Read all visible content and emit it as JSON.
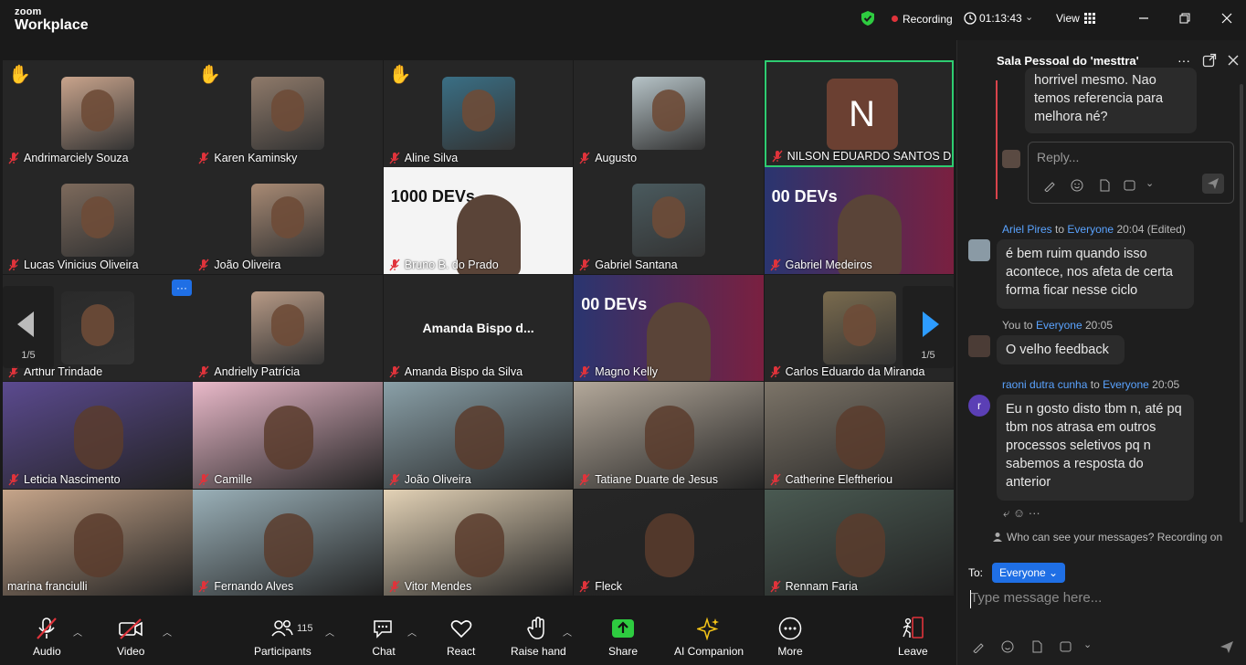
{
  "titlebar": {
    "brand_top": "zoom",
    "brand_bottom": "Workplace",
    "recording": "Recording",
    "timer": "01:13:43",
    "view": "View"
  },
  "participants": [
    {
      "name": "Andrimarciely Souza",
      "hand": true
    },
    {
      "name": "Karen Kaminsky",
      "hand": true
    },
    {
      "name": "Aline Silva",
      "hand": true
    },
    {
      "name": "Augusto",
      "hand": false
    },
    {
      "name": "NILSON EDUARDO SANTOS DE ...",
      "initial": "N"
    },
    {
      "name": "Lucas Vinicius Oliveira"
    },
    {
      "name": "João Oliveira"
    },
    {
      "name": "Bruno B. do Prado",
      "banner": "1000 DEVs"
    },
    {
      "name": "Gabriel Santana"
    },
    {
      "name": "Gabriel Medeiros",
      "banner": "00 DEVs"
    },
    {
      "name": "Arthur Trindade"
    },
    {
      "name": "Andrielly Patrícia"
    },
    {
      "name": "Amanda Bispo da Silva",
      "display": "Amanda Bispo d..."
    },
    {
      "name": "Magno Kelly",
      "banner": "00 DEVs"
    },
    {
      "name": "Carlos Eduardo da Miranda"
    },
    {
      "name": "Leticia Nascimento"
    },
    {
      "name": "Camille"
    },
    {
      "name": "João Oliveira"
    },
    {
      "name": "Tatiane Duarte de Jesus"
    },
    {
      "name": "Catherine Eleftheriou"
    },
    {
      "name": "marina franciulli"
    },
    {
      "name": "Fernando Alves"
    },
    {
      "name": "Vitor Mendes"
    },
    {
      "name": "Fleck"
    },
    {
      "name": "Rennam Faria"
    }
  ],
  "pager": {
    "left": "1/5",
    "right": "1/5"
  },
  "dots_label": "···",
  "chat": {
    "title": "Sala Pessoal do 'mesttra'",
    "quoted_text_1": "horrivel mesmo. Nao",
    "quoted_text_2": "temos referencia para",
    "quoted_text_3": "melhora né?",
    "reply_placeholder": "Reply...",
    "messages": [
      {
        "sender": "Ariel Pires",
        "to_word": "to",
        "recipient": "Everyone",
        "time": "20:04 (Edited)",
        "text": "é bem ruim quando isso acontece, nos afeta de certa forma ficar nesse ciclo"
      },
      {
        "sender": "You",
        "to_word": "to",
        "recipient": "Everyone",
        "time": "20:05",
        "text": "O velho feedback"
      },
      {
        "sender": "raoni dutra cunha",
        "to_word": "to",
        "recipient": "Everyone",
        "time": "20:05",
        "text": "Eu n gosto disto tbm n, até pq tbm nos atrasa em outros processos seletivos pq n sabemos a resposta do anterior",
        "avatar_letter": "r"
      }
    ],
    "notice": "Who can see your messages? Recording on",
    "to_label": "To:",
    "to_value": "Everyone",
    "input_placeholder": "Type message here..."
  },
  "toolbar": {
    "audio": "Audio",
    "video": "Video",
    "participants": "Participants",
    "participants_count": "115",
    "chat": "Chat",
    "react": "React",
    "raise_hand": "Raise hand",
    "share": "Share",
    "ai": "AI Companion",
    "more": "More",
    "leave": "Leave"
  },
  "colors": {
    "accent": "#1f6fe5",
    "recording": "#e0333b",
    "share_green": "#2ecc40",
    "leave_red": "#e0333b",
    "active_speaker_border": "#2ecc71",
    "link_blue": "#5aa3ff"
  }
}
